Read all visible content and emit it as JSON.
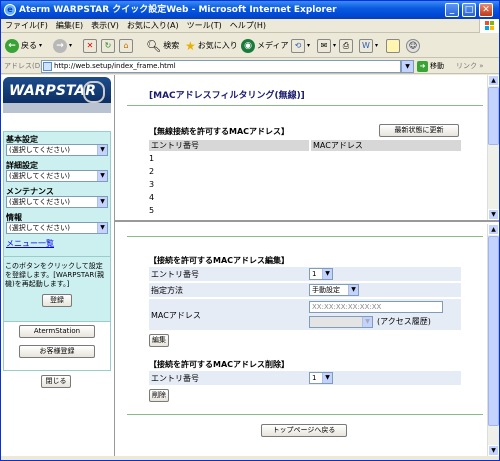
{
  "window": {
    "title": "Aterm WARPSTAR クイック設定Web - Microsoft Internet Explorer",
    "min": "_",
    "max": "□",
    "close": "✕"
  },
  "menubar": [
    "ファイル(F)",
    "編集(E)",
    "表示(V)",
    "お気に入り(A)",
    "ツール(T)",
    "ヘルプ(H)"
  ],
  "toolbar": {
    "back": "戻る",
    "search": "検索",
    "favorites": "お気に入り",
    "media": "メディア"
  },
  "address": {
    "label": "アドレス(D)",
    "url": "http://web.setup/index_frame.html",
    "go": "移動",
    "links": "リンク"
  },
  "sidebar": {
    "logo": "WARPSTAR",
    "sections": [
      {
        "label": "基本設定",
        "value": "(選択してください)"
      },
      {
        "label": "詳細設定",
        "value": "(選択してください)"
      },
      {
        "label": "メンテナンス",
        "value": "(選択してください)"
      },
      {
        "label": "情報",
        "value": "(選択してください)"
      }
    ],
    "menu_list": "メニュー一覧",
    "info_text": "このボタンをクリックして設定を登録します。[WARPSTAR(親機)を再起動します。]",
    "register": "登録",
    "aterm_station": "AtermStation",
    "customer_reg": "お客様登録",
    "close": "閉じる"
  },
  "top_frame": {
    "page_title": "[MACアドレスフィルタリング(無線)]",
    "section_title": "【無線接続を許可するMACアドレス】",
    "refresh": "最新状態に更新",
    "col_entry": "エントリ番号",
    "col_mac": "MACアドレス",
    "rows": [
      "1",
      "2",
      "3",
      "4",
      "5"
    ]
  },
  "bottom_frame": {
    "edit_title": "【接続を許可するMACアドレス編集】",
    "entry_label": "エントリ番号",
    "entry_value": "1",
    "method_label": "指定方法",
    "method_value": "手動設定",
    "mac_label": "MACアドレス",
    "mac_placeholder": "XX:XX:XX:XX:XX:XX",
    "access_history": "(アクセス履歴)",
    "edit_button": "編集",
    "delete_title": "【接続を許可するMACアドレス削除】",
    "delete_entry_label": "エントリ番号",
    "delete_entry_value": "1",
    "delete_button": "削除",
    "top_page": "トップページへ戻る"
  }
}
